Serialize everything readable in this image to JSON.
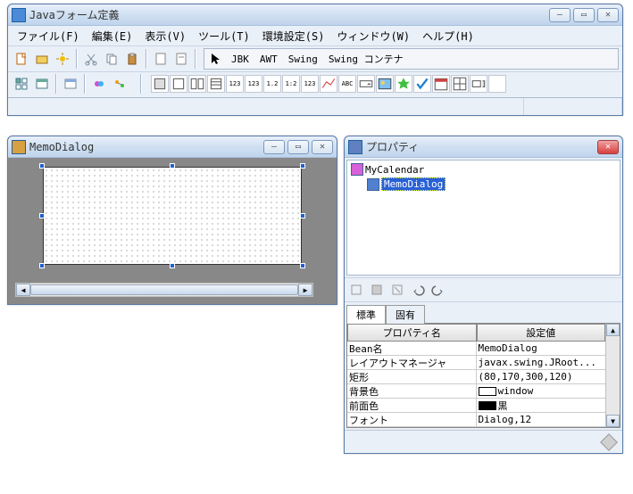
{
  "main_window": {
    "title": "Javaフォーム定義",
    "menu": {
      "file": "ファイル(F)",
      "edit": "編集(E)",
      "view": "表示(V)",
      "tool": "ツール(T)",
      "env": "環境設定(S)",
      "window": "ウィンドウ(W)",
      "help": "ヘルプ(H)"
    },
    "palette_tabs": {
      "jbk": "JBK",
      "awt": "AWT",
      "swing": "Swing",
      "swing_container": "Swing コンテナ"
    }
  },
  "child_window": {
    "title": "MemoDialog"
  },
  "props_window": {
    "title": "プロパティ",
    "tree": {
      "root": "MyCalendar",
      "child": "MemoDialog"
    },
    "tabs": {
      "standard": "標準",
      "specific": "固有"
    },
    "headers": {
      "name": "プロパティ名",
      "value": "設定値"
    },
    "rows": [
      {
        "name": "Bean名",
        "value": "MemoDialog"
      },
      {
        "name": "レイアウトマネージャ",
        "value": "javax.swing.JRoot..."
      },
      {
        "name": "矩形",
        "value": "(80,170,300,120)"
      },
      {
        "name": "背景色",
        "value": "window",
        "swatch": "#ffffff"
      },
      {
        "name": "前面色",
        "value": "黒",
        "swatch": "#000000"
      },
      {
        "name": "フォント",
        "value": "Dialog,12"
      }
    ]
  }
}
